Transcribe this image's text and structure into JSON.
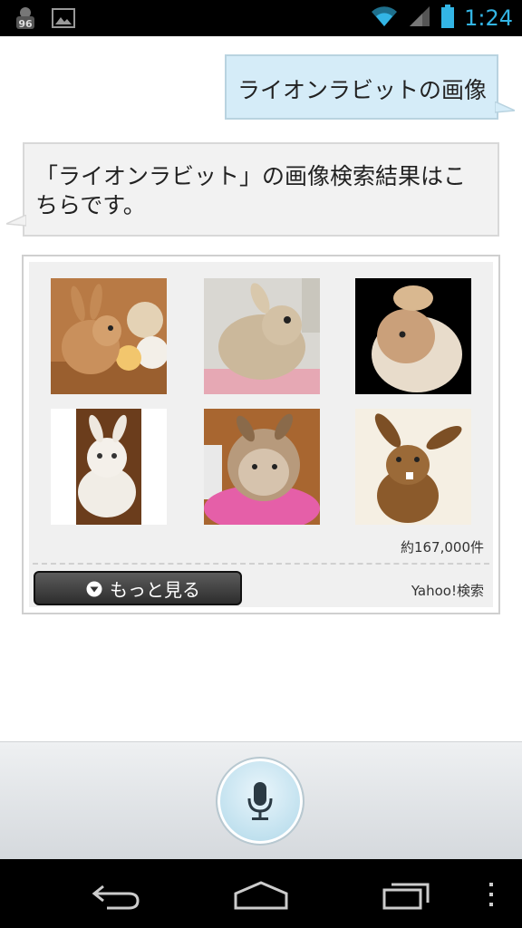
{
  "status_bar": {
    "notification_badge": "96",
    "time": "1:24",
    "accent_color": "#33b5e5"
  },
  "conversation": {
    "user_query": "ライオンラビットの画像",
    "assistant_reply": "「ライオンラビット」の画像検索結果はこちらです。"
  },
  "results": {
    "thumbnails": [
      {
        "icon": "rabbit-with-toys-image"
      },
      {
        "icon": "fluffy-rabbit-image"
      },
      {
        "icon": "rabbit-on-black-image"
      },
      {
        "icon": "white-rabbit-image"
      },
      {
        "icon": "shaggy-rabbit-image"
      },
      {
        "icon": "brown-rabbit-image"
      }
    ],
    "count_label": "約167,000件",
    "more_button_label": "もっと見る",
    "source_label": "Yahoo!検索"
  },
  "colors": {
    "user_bubble": "#d5ecf8",
    "assistant_bubble": "#f2f2f2",
    "mic_button": "#bfe0ee"
  }
}
